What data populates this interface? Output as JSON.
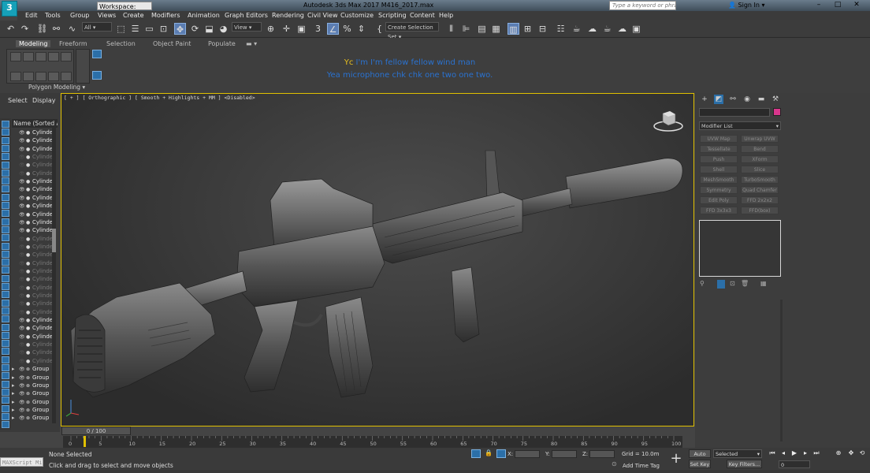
{
  "titlebar": {
    "app_logo": "3",
    "workspace": "Workspace: Default",
    "title": "Autodesk 3ds Max 2017      M416_2017.max",
    "search_placeholder": "Type a keyword or phrase",
    "sign_in": "Sign In",
    "minimize": "–",
    "maximize": "□",
    "close": "✕"
  },
  "menu": [
    "Edit",
    "Tools",
    "Group",
    "Views",
    "Create",
    "Modifiers",
    "Animation",
    "Graph Editors",
    "Rendering",
    "Civil View",
    "Customize",
    "Scripting",
    "Content",
    "Help"
  ],
  "toolbar": {
    "filter_select": "All",
    "view_select": "View",
    "create_selection_set": "Create Selection Set"
  },
  "ribbon": {
    "tabs": [
      "Modeling",
      "Freeform",
      "Selection",
      "Object Paint",
      "Populate"
    ],
    "active_tab": "Modeling",
    "panel_label": "Polygon Modeling"
  },
  "subtitles": {
    "line1_prefix": "Yc",
    "line1": " I'm I'm fellow fellow wind man",
    "line2": "Yea microphone chk chk one two one two."
  },
  "scene_explorer": {
    "tab_select": "Select",
    "tab_display": "Display",
    "header": "Name (Sorted Ascending)",
    "rows": [
      {
        "name": "Cylinder",
        "visible": true
      },
      {
        "name": "Cylinder",
        "visible": true
      },
      {
        "name": "Cylinder",
        "visible": true
      },
      {
        "name": "Cylinder",
        "visible": false
      },
      {
        "name": "Cylinder",
        "visible": false
      },
      {
        "name": "Cylinder",
        "visible": false
      },
      {
        "name": "Cylinder",
        "visible": true
      },
      {
        "name": "Cylinder",
        "visible": true
      },
      {
        "name": "Cylinder",
        "visible": true
      },
      {
        "name": "Cylinder",
        "visible": true
      },
      {
        "name": "Cylinder",
        "visible": true
      },
      {
        "name": "Cylinder",
        "visible": true
      },
      {
        "name": "Cylinder",
        "visible": true
      },
      {
        "name": "Cylinder",
        "visible": false
      },
      {
        "name": "Cylinder",
        "visible": false
      },
      {
        "name": "Cylinder",
        "visible": false
      },
      {
        "name": "Cylinder",
        "visible": false
      },
      {
        "name": "Cylinder",
        "visible": false
      },
      {
        "name": "Cylinder",
        "visible": false
      },
      {
        "name": "Cylinder",
        "visible": false
      },
      {
        "name": "Cylinder",
        "visible": false
      },
      {
        "name": "Cylinder",
        "visible": false
      },
      {
        "name": "Cylinder",
        "visible": false
      },
      {
        "name": "Cylinder",
        "visible": true
      },
      {
        "name": "Cylinder",
        "visible": true
      },
      {
        "name": "Cylinder",
        "visible": true
      },
      {
        "name": "Cylinder",
        "visible": false
      },
      {
        "name": "Cylinder",
        "visible": false
      },
      {
        "name": "Cylinder",
        "visible": false
      },
      {
        "name": "Group",
        "visible": true
      },
      {
        "name": "Group",
        "visible": true
      },
      {
        "name": "Group",
        "visible": true
      },
      {
        "name": "Group",
        "visible": true
      },
      {
        "name": "Group",
        "visible": true
      },
      {
        "name": "Group",
        "visible": true
      },
      {
        "name": "Group",
        "visible": true
      }
    ]
  },
  "viewport": {
    "label": "[ + ] [ Orthographic ] [ Smooth + Highlights + MM ] <Disabled>"
  },
  "timeline": {
    "slider": "0 / 100",
    "ticks": [
      "0",
      "5",
      "10",
      "15",
      "20",
      "25",
      "30",
      "35",
      "40",
      "45",
      "50",
      "55",
      "60",
      "65",
      "70",
      "75",
      "80",
      "85",
      "90",
      "95",
      "100"
    ]
  },
  "status": {
    "maxscript": "MAXScript Mi",
    "selection": "None Selected",
    "hint": "Click and drag to select and move objects",
    "x_label": "X:",
    "y_label": "Y:",
    "z_label": "Z:",
    "grid": "Grid = 10.0m",
    "add_time_tag": "Add Time Tag",
    "auto_key": "Auto Key",
    "set_key": "Set Key",
    "selected": "Selected",
    "key_filters": "Key Filters...",
    "frame": "0"
  },
  "command_panel": {
    "modifier_list": "Modifier List",
    "modifiers": [
      "UVW Map",
      "Unwrap UVW",
      "Tessellate",
      "Bend",
      "Push",
      "XForm",
      "Shell",
      "Slice",
      "MeshSmooth",
      "TurboSmooth",
      "Symmetry",
      "Quad Chamfer",
      "Edit Poly",
      "FFD 2x2x2",
      "FFD 3x3x3",
      "FFD(box)"
    ],
    "object_color": "#d8368c"
  }
}
